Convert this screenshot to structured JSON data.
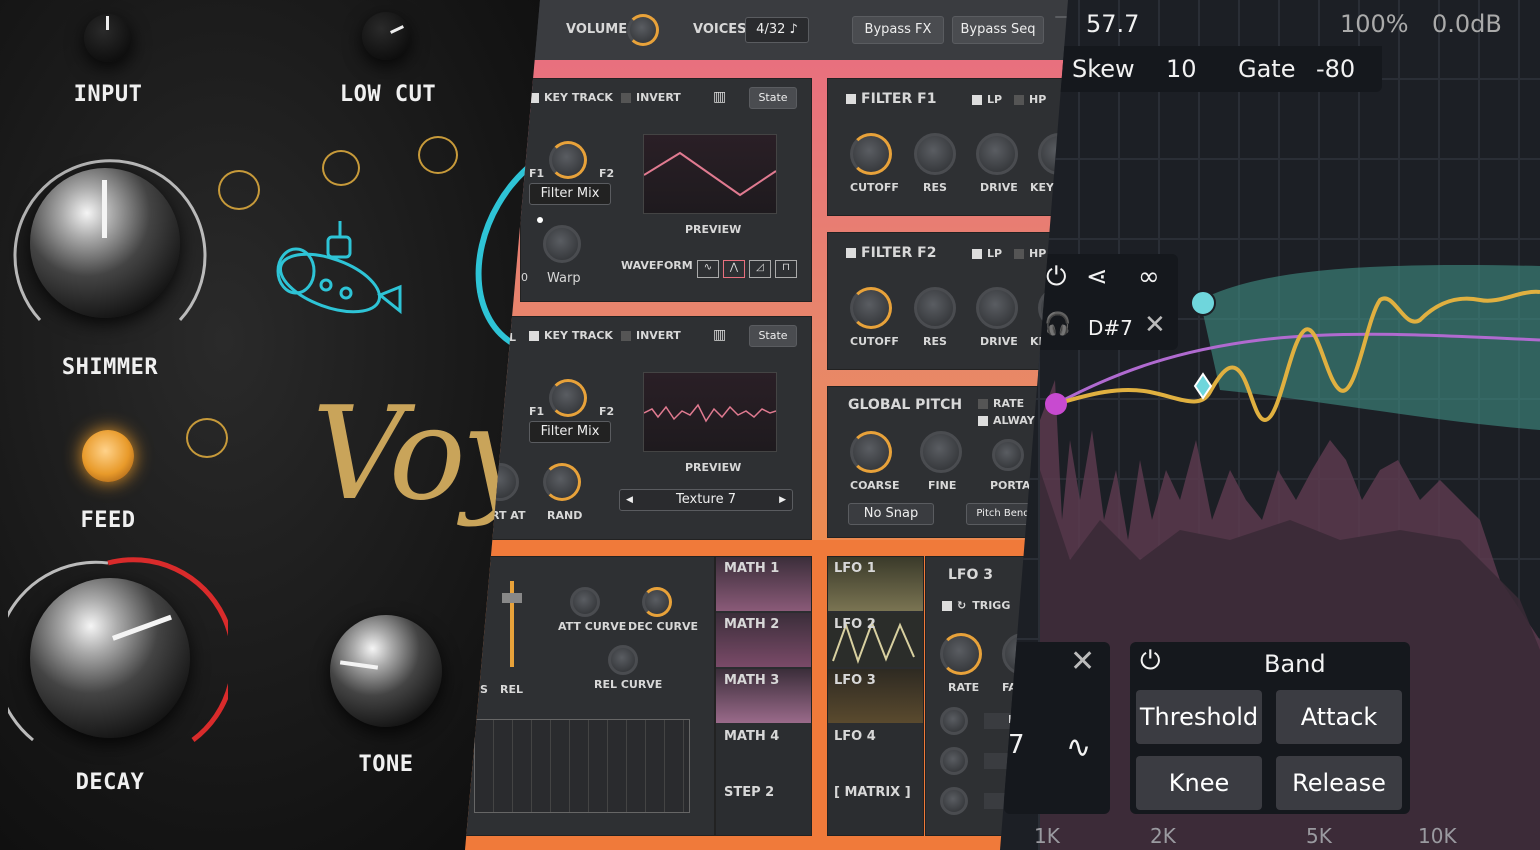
{
  "left_panel": {
    "knobs": {
      "input": "INPUT",
      "low_cut": "LOW CUT",
      "shimmer": "SHIMMER",
      "feed": "FEED",
      "decay": "DECAY",
      "tone": "TONE"
    },
    "logo_text": "Voya",
    "colors": {
      "logo": "#c9a45a",
      "accent_ring": "#c79a3a",
      "sub_icon": "#2ec4d6",
      "decay_arc": "#d92b2b"
    }
  },
  "mid_panel": {
    "top_bar": {
      "volume_label": "VOLUME",
      "voices_label": "VOICES",
      "voices_value": "4/32",
      "bypass_fx": "Bypass FX",
      "bypass_seq": "Bypass Seq"
    },
    "osc_a": {
      "key_track": "KEY TRACK",
      "invert": "INVERT",
      "state": "State",
      "f1": "F1",
      "f2": "F2",
      "filter_mix": "Filter Mix",
      "warp": "Warp",
      "preview": "PREVIEW",
      "waveform": "WAVEFORM",
      "edge_value": "0"
    },
    "osc_b": {
      "key_track": "KEY TRACK",
      "invert": "INVERT",
      "state": "State",
      "f1": "F1",
      "f2": "F2",
      "filter_mix": "Filter Mix",
      "rand": "RAND",
      "rt_at": "RT AT",
      "preview": "PREVIEW",
      "texture": "Texture 7",
      "edge_l": "L"
    },
    "filter_f1": {
      "title": "FILTER F1",
      "lp": "LP",
      "hp": "HP",
      "cutoff": "CUTOFF",
      "res": "RES",
      "drive": "DRIVE",
      "key": "KEY T"
    },
    "filter_f2": {
      "title": "FILTER F2",
      "lp": "LP",
      "hp": "HP",
      "cutoff": "CUTOFF",
      "res": "RES",
      "drive": "DRIVE",
      "key": "KE"
    },
    "global_pitch": {
      "title": "GLOBAL PITCH",
      "rate": "RATE",
      "always": "ALWAYS",
      "coarse": "COARSE",
      "fine": "FINE",
      "porta": "PORTA",
      "no_snap": "No Snap",
      "pitch_bend": "Pitch Bend"
    },
    "envelope": {
      "rel": "REL",
      "s": "S",
      "att_curve": "ATT CURVE",
      "dec_curve": "DEC CURVE",
      "rel_curve": "REL CURVE"
    },
    "math_list": [
      "MATH 1",
      "MATH 2",
      "MATH 3",
      "MATH 4",
      "STEP 2"
    ],
    "lfo_list": [
      "LFO 1",
      "LFO 2",
      "LFO 3",
      "LFO 4",
      "[ MATRIX ]"
    ],
    "lfo3": {
      "title": "LFO 3",
      "trigg": "TRIGG",
      "rate": "RATE",
      "fa": "FA",
      "edge": "L"
    },
    "colors": {
      "pink_band": "#e8707e",
      "orange_band": "#f07a3a",
      "knob_accent": "#e8a23a"
    }
  },
  "right_panel": {
    "header": {
      "value": "57.7",
      "percent": "100%",
      "gain": "0.0dB"
    },
    "params": {
      "skew_label": "Skew",
      "skew_value": "10",
      "gate_label": "Gate",
      "gate_value": "-80"
    },
    "node": {
      "note": "D#7"
    },
    "band_panel": {
      "title": "Band",
      "threshold": "Threshold",
      "attack": "Attack",
      "knee": "Knee",
      "release": "Release"
    },
    "side_value": "7",
    "freq_ticks": [
      "1K",
      "2K",
      "5K",
      "10K"
    ],
    "colors": {
      "band_fill": "#3f8f86",
      "curve_gold": "#e0b040",
      "node_cyan": "#6fd6dc",
      "node_magenta": "#c84ad0",
      "spectrum": "#5a3a4e"
    }
  }
}
